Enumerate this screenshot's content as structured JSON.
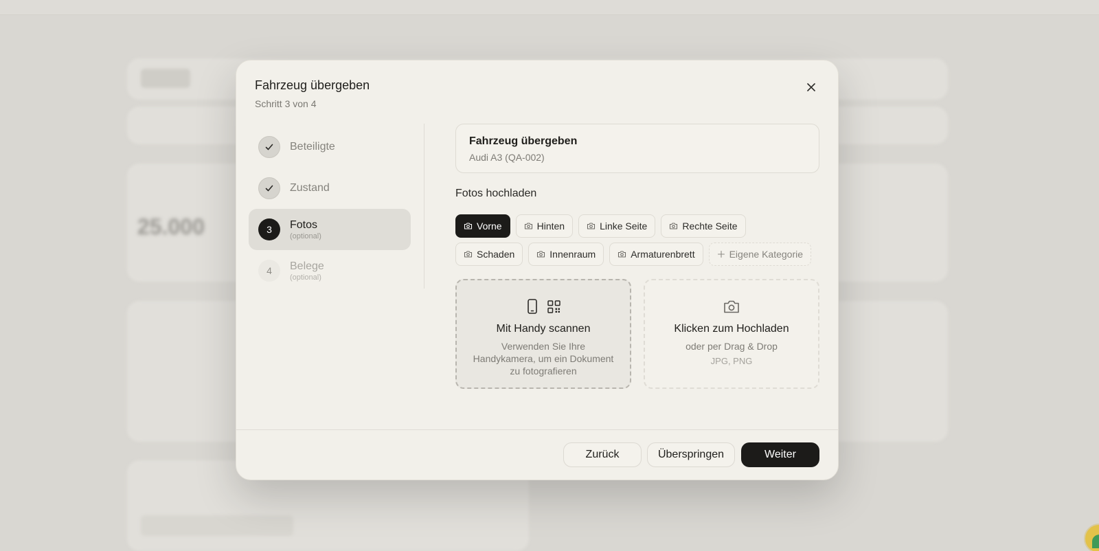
{
  "modal": {
    "title": "Fahrzeug übergeben",
    "subtitle": "Schritt 3 von 4"
  },
  "steps": [
    {
      "number": "",
      "label": "Beteiligte",
      "optional": "",
      "state": "done"
    },
    {
      "number": "",
      "label": "Zustand",
      "optional": "",
      "state": "done"
    },
    {
      "number": "3",
      "label": "Fotos",
      "optional": "(optional)",
      "state": "current"
    },
    {
      "number": "4",
      "label": "Belege",
      "optional": "(optional)",
      "state": "todo"
    }
  ],
  "vehicle": {
    "title": "Fahrzeug übergeben",
    "subtitle": "Audi A3 (QA-002)"
  },
  "photos": {
    "section_title": "Fotos hochladen",
    "categories": [
      "Vorne",
      "Hinten",
      "Linke Seite",
      "Rechte Seite",
      "Schaden",
      "Innenraum",
      "Armaturenbrett"
    ],
    "selected_category": "Vorne",
    "add_category": "Eigene Kategorie"
  },
  "scan": {
    "title": "Mit Handy scannen",
    "description": "Verwenden Sie Ihre Handykamera, um ein Dokument zu fotografieren"
  },
  "upload": {
    "title": "Klicken zum Hochladen",
    "description": "oder per Drag & Drop",
    "formats": "JPG, PNG"
  },
  "footer": {
    "back": "Zurück",
    "skip": "Überspringen",
    "next": "Weiter"
  },
  "icons": {
    "close": "close-icon",
    "check": "check-icon",
    "camera": "camera-icon",
    "plus": "plus-icon",
    "phone": "phone-icon",
    "qr": "qr-code-icon"
  },
  "colors": {
    "accent": "#1c1b19",
    "modal_bg": "#f2f0ea",
    "backdrop": "#d9d7d2"
  }
}
